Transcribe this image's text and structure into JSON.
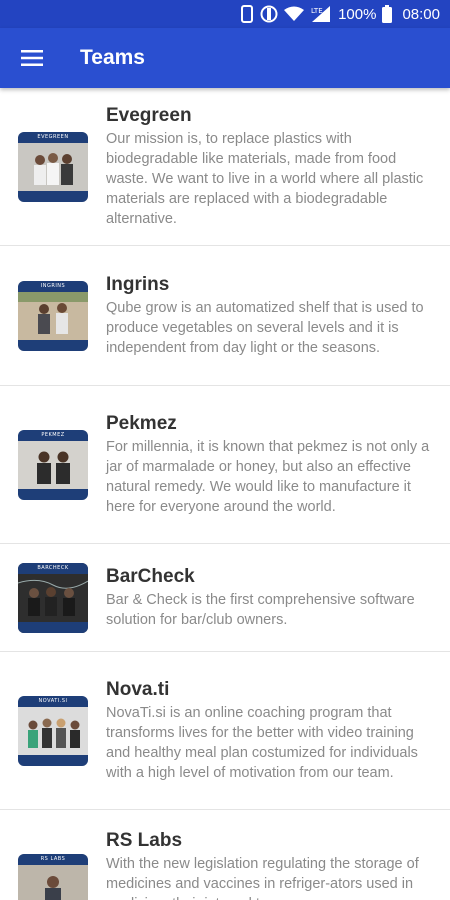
{
  "status_bar": {
    "battery_pct": "100%",
    "time": "08:00",
    "network": "LTE"
  },
  "app_bar": {
    "title": "Teams",
    "menu_icon": "hamburger-menu-icon"
  },
  "teams": [
    {
      "name": "Evegreen",
      "thumb_label": "EVEGREEN",
      "description": "Our mission is, to replace plastics with biodegradable like materials, made from food waste. We want to live in a world where all plastic materials are replaced with a biodegradable alternative."
    },
    {
      "name": "Ingrins",
      "thumb_label": "INGRINS",
      "description": "Qube grow is an automatized shelf that is used to produce vegetables on several levels and it is independent from day light or the seasons."
    },
    {
      "name": "Pekmez",
      "thumb_label": "PEKMEZ",
      "description": "For millennia, it is known that pekmez is not only a jar of marmalade or honey, but also an effective natural remedy. We would like to manufacture it here for everyone around the world."
    },
    {
      "name": "BarCheck",
      "thumb_label": "BARCHECK",
      "description": "Bar & Check is the first comprehensive software solution for bar/club owners."
    },
    {
      "name": "Nova.ti",
      "thumb_label": "NOVATI.SI",
      "description": "NovaTi.si is an online coaching program that transforms lives for the better with video training and healthy meal plan costumized for individuals with a high level of motivation from our team."
    },
    {
      "name": "RS Labs",
      "thumb_label": "RS LABS",
      "description": "With the new legislation regulating the storage of medicines and vaccines in refriger-ators used in medicine, their internal temper-"
    }
  ],
  "colors": {
    "status_bar": "#2344c1",
    "app_bar": "#2a4fd0",
    "title_text": "#333333",
    "desc_text": "#8a8a8a",
    "divider": "#e4e4e4"
  }
}
